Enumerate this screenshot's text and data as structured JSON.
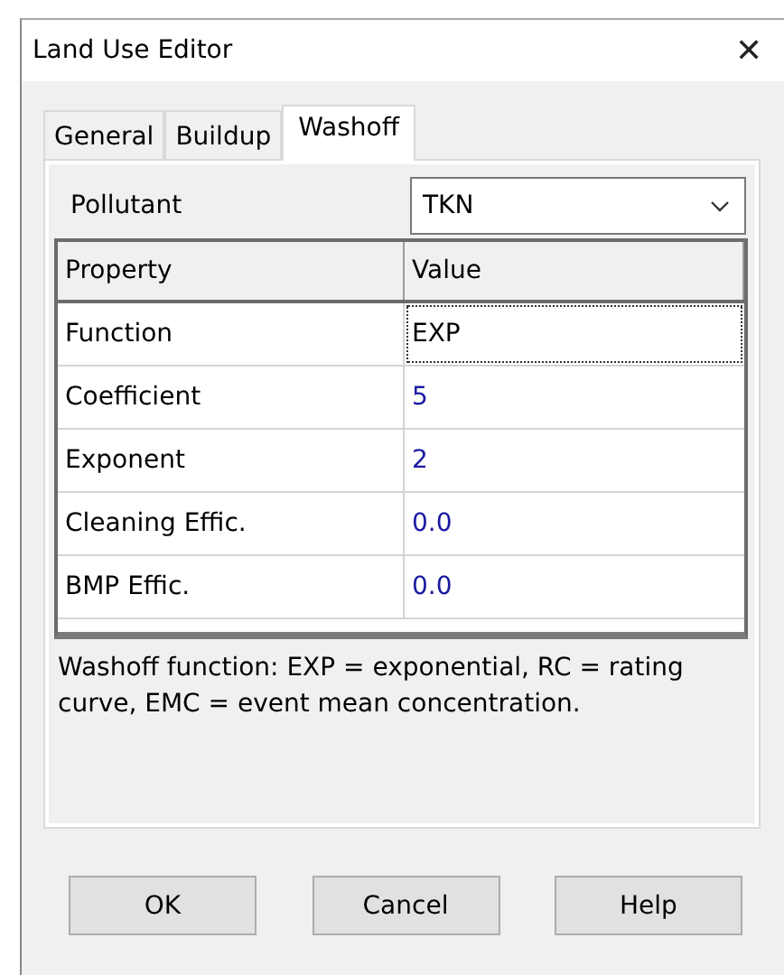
{
  "window": {
    "title": "Land Use Editor",
    "close": "✕"
  },
  "tabs": [
    {
      "label": "General",
      "selected": false
    },
    {
      "label": "Buildup",
      "selected": false
    },
    {
      "label": "Washoff",
      "selected": true
    }
  ],
  "pollutant": {
    "label": "Pollutant",
    "value": "TKN"
  },
  "grid": {
    "columns": [
      "Property",
      "Value"
    ],
    "rows": [
      {
        "property": "Function",
        "value": "EXP",
        "focused": true
      },
      {
        "property": "Coefficient",
        "value": "5",
        "focused": false
      },
      {
        "property": "Exponent",
        "value": "2",
        "focused": false
      },
      {
        "property": "Cleaning Effic.",
        "value": "0.0",
        "focused": false
      },
      {
        "property": "BMP Effic.",
        "value": "0.0",
        "focused": false
      }
    ]
  },
  "description": "Washoff function: EXP = exponential, RC = rating curve, EMC = event mean concentration.",
  "buttons": [
    "OK",
    "Cancel",
    "Help"
  ]
}
